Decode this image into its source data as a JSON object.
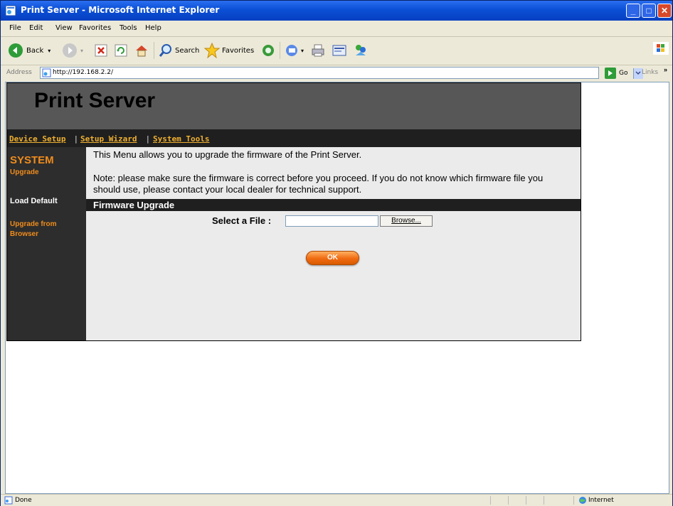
{
  "window": {
    "title": "Print Server - Microsoft Internet Explorer"
  },
  "menu": [
    "File",
    "Edit",
    "View",
    "Favorites",
    "Tools",
    "Help"
  ],
  "toolbar": {
    "back_label": "Back",
    "search_label": "Search",
    "favorites_label": "Favorites"
  },
  "address": {
    "label": "Address",
    "url": "http://192.168.2.2/",
    "go_label": "Go",
    "links_label": "Links"
  },
  "page": {
    "title": "Print Server",
    "nav": [
      "Device Setup",
      "Setup Wizard",
      "System Tools"
    ],
    "nav_separator": "|",
    "sidebar": {
      "section": "SYSTEM",
      "current": "Upgrade",
      "items": [
        "Load Default",
        "Upgrade from Browser"
      ]
    },
    "intro": "This Menu allows you to upgrade the firmware of the Print Server.",
    "note": "Note: please make sure the firmware is correct before you proceed. If you do not know which firmware file you should use, please contact your local dealer for technical support.",
    "section_title": "Firmware Upgrade",
    "file_label": "Select a File :",
    "file_value": "",
    "browse_label": "Browse...",
    "ok_label": "OK"
  },
  "status": {
    "text": "Done",
    "zone": "Internet"
  },
  "colors": {
    "banner": "#575757",
    "navbar": "#1f1f1f",
    "accent": "#f08c1c",
    "content_bg": "#ebebeb"
  }
}
